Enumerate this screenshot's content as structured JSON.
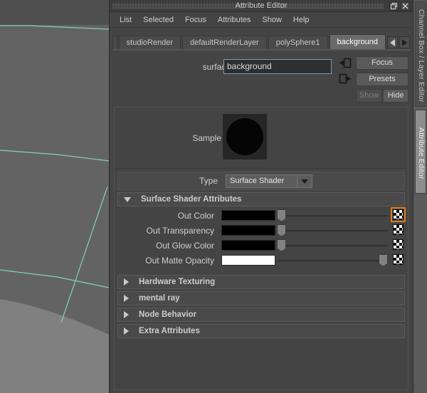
{
  "window": {
    "title": "Attribute Editor",
    "restore_icon": "restore-icon",
    "close_icon": "close-icon"
  },
  "menubar": {
    "items": [
      {
        "label": "List"
      },
      {
        "label": "Selected"
      },
      {
        "label": "Focus"
      },
      {
        "label": "Attributes"
      },
      {
        "label": "Show"
      },
      {
        "label": "Help"
      }
    ]
  },
  "tabs": {
    "items": [
      {
        "label": "studioRender",
        "active": false
      },
      {
        "label": "defaultRenderLayer",
        "active": false
      },
      {
        "label": "polySphere1",
        "active": false
      },
      {
        "label": "background",
        "active": true
      }
    ],
    "prev_icon": "chevron-left-icon",
    "next_icon": "chevron-right-icon"
  },
  "node": {
    "field_label": "surfaceShader:",
    "field_value": "background",
    "input_connection_icon": "connection-input-icon",
    "output_connection_icon": "connection-output-icon"
  },
  "side_buttons": {
    "focus": "Focus",
    "presets": "Presets",
    "show": "Show",
    "hide": "Hide"
  },
  "sample": {
    "label": "Sample",
    "swatch_color": "#050505",
    "swatch_bg": "#262626"
  },
  "type": {
    "label": "Type",
    "value": "Surface Shader",
    "dropdown_icon": "chevron-down-icon"
  },
  "surface_shader_attributes": {
    "title": "Surface Shader Attributes",
    "expanded": true,
    "expand_icon": "triangle-down-icon",
    "rows": [
      {
        "label": "Out Color",
        "color": "#000000",
        "slider_pct": 0,
        "map_icon": "checker-map-icon",
        "map_highlighted": true
      },
      {
        "label": "Out Transparency",
        "color": "#000000",
        "slider_pct": 0,
        "map_icon": "checker-map-icon",
        "map_highlighted": false
      },
      {
        "label": "Out Glow Color",
        "color": "#000000",
        "slider_pct": 0,
        "map_icon": "checker-map-icon",
        "map_highlighted": false
      },
      {
        "label": "Out Matte Opacity",
        "color": "#ffffff",
        "slider_pct": 100,
        "map_icon": "checker-map-icon",
        "map_highlighted": false
      }
    ]
  },
  "collapsed_sections": [
    {
      "title": "Hardware Texturing",
      "expand_icon": "triangle-right-icon"
    },
    {
      "title": "mental ray",
      "expand_icon": "triangle-right-icon"
    },
    {
      "title": "Node Behavior",
      "expand_icon": "triangle-right-icon"
    },
    {
      "title": "Extra Attributes",
      "expand_icon": "triangle-right-icon"
    }
  ],
  "right_tabs": {
    "channel_box": "Channel Box / Layer Editor",
    "attribute_editor": "Attribute Editor"
  },
  "viewport": {
    "wireframe_color": "#7fd6b0",
    "surface_color": "#636363",
    "background_color": "#4f4f4f"
  },
  "colors": {
    "accent": "#e07b18",
    "panel_bg": "#444444",
    "field_focus_border": "#7d9fbb"
  }
}
